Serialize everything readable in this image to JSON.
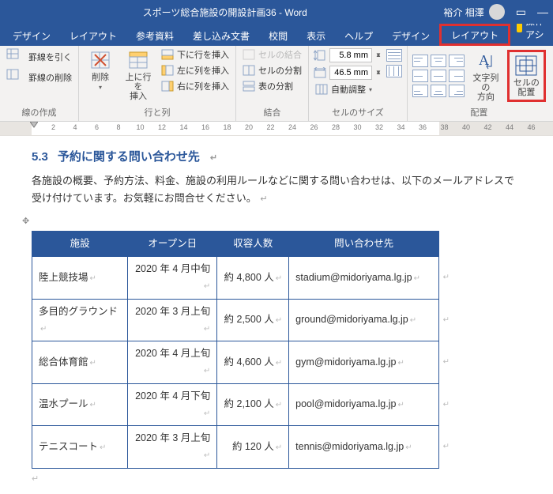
{
  "app": {
    "title": "スポーツ総合施設の開設計画36 - Word"
  },
  "user": {
    "name": "裕介 相澤"
  },
  "tabs": {
    "design": "デザイン",
    "layout_page": "レイアウト",
    "references": "参考資料",
    "mailings": "差し込み文書",
    "review": "校閲",
    "view": "表示",
    "help": "ヘルプ",
    "table_design": "デザイン",
    "table_layout": "レイアウト",
    "op_assist": "操作アシ"
  },
  "ribbon": {
    "draw_group": {
      "draw_borders": "罫線を引く",
      "erase_borders": "罫線の削除",
      "label": "線の作成"
    },
    "rows_cols": {
      "delete": "削除",
      "insert_above": "上に行を\n挿入",
      "insert_below": "下に行を挿入",
      "insert_left": "左に列を挿入",
      "insert_right": "右に列を挿入",
      "label": "行と列"
    },
    "merge": {
      "merge_cells": "セルの結合",
      "split_cells": "セルの分割",
      "split_table": "表の分割",
      "label": "結合"
    },
    "size": {
      "height": "5.8 mm",
      "width": "46.5 mm",
      "autofit": "自動調整",
      "label": "セルのサイズ"
    },
    "align": {
      "text_direction": "文字列の\n方向",
      "cell_margins": "セルの\n配置",
      "label": "配置"
    }
  },
  "ruler": {
    "marks": [
      "2",
      "4",
      "6",
      "8",
      "10",
      "12",
      "14",
      "16",
      "18",
      "20",
      "22",
      "24",
      "26",
      "28",
      "30",
      "32",
      "34",
      "36",
      "38",
      "40",
      "42",
      "44",
      "46"
    ]
  },
  "doc": {
    "sec_num": "5.3",
    "sec_title": "予約に関する問い合わせ先",
    "body1": "各施設の概要、予約方法、料金、施設の利用ルールなどに関する問い合わせは、以下のメールアドレスで受け付けています。お気軽にお問合せください。",
    "headers": [
      "施設",
      "オープン日",
      "収容人数",
      "問い合わせ先"
    ],
    "rows": [
      [
        "陸上競技場",
        "2020 年 4 月中旬",
        "約 4,800 人",
        "stadium@midoriyama.lg.jp"
      ],
      [
        "多目的グラウンド",
        "2020 年 3 月上旬",
        "約 2,500 人",
        "ground@midoriyama.lg.jp"
      ],
      [
        "総合体育館",
        "2020 年 4 月上旬",
        "約 4,600 人",
        "gym@midoriyama.lg.jp"
      ],
      [
        "温水プール",
        "2020 年 4 月下旬",
        "約 2,100 人",
        "pool@midoriyama.lg.jp"
      ],
      [
        "テニスコート",
        "2020 年 3 月上旬",
        "約 120 人",
        "tennis@midoriyama.lg.jp"
      ]
    ]
  }
}
